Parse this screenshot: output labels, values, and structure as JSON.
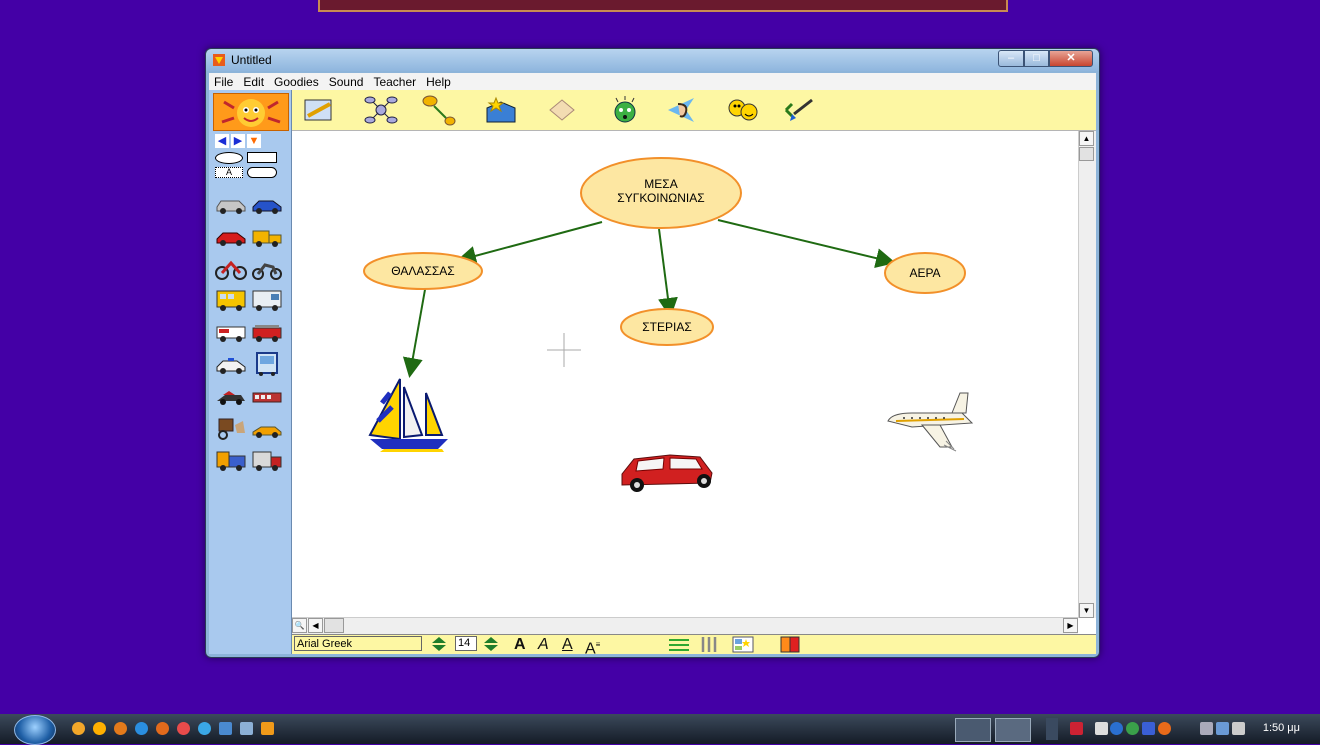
{
  "window": {
    "title": "Untitled"
  },
  "menu": [
    "File",
    "Edit",
    "Goodies",
    "Sound",
    "Teacher",
    "Help"
  ],
  "palette": {
    "shape_text_label": "A"
  },
  "diagram": {
    "nodes": {
      "root": "ΜΕΣΑ ΣΥΓΚΟΙΝΩΝΙΑΣ",
      "sea": "ΘΑΛΑΣΣΑΣ",
      "land": "ΣΤΕΡΙΑΣ",
      "air": "ΑΕΡΑ"
    },
    "images": [
      "sailboat",
      "car",
      "airplane"
    ]
  },
  "format_bar": {
    "font": "Arial Greek",
    "size": "14"
  },
  "taskbar": {
    "clock": "1:50 μμ"
  }
}
